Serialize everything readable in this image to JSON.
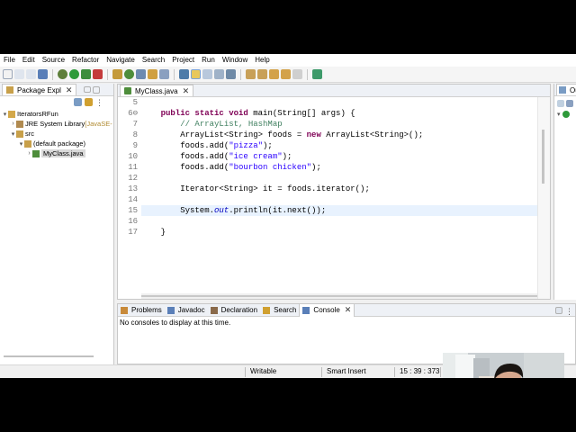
{
  "menu": [
    "File",
    "Edit",
    "Source",
    "Refactor",
    "Navigate",
    "Search",
    "Project",
    "Run",
    "Window",
    "Help"
  ],
  "package_explorer": {
    "tab_label": "Package Expl",
    "tree": [
      {
        "label": "IteratorsRFun",
        "icon": "project-icon",
        "depth": 0,
        "twisty": "▾"
      },
      {
        "label": "JRE System Library ",
        "suffix": "[JavaSE-",
        "icon": "library-icon",
        "depth": 1,
        "twisty": "›"
      },
      {
        "label": "src",
        "icon": "source-folder-icon",
        "depth": 1,
        "twisty": "▾"
      },
      {
        "label": "(default package)",
        "icon": "package-icon",
        "depth": 2,
        "twisty": "▾"
      },
      {
        "label": "MyClass.java",
        "icon": "java-file-icon",
        "depth": 3,
        "twisty": "›"
      }
    ]
  },
  "editor": {
    "tab_label": "MyClass.java",
    "lines": [
      {
        "n": "5",
        "html": ""
      },
      {
        "n": "6⊖",
        "html": "    <span class='kw'>public</span> <span class='kw'>static</span> <span class='kw'>void</span> main(String[] args) {"
      },
      {
        "n": "7",
        "html": "        <span class='cm'>// ArrayList, HashMap</span>"
      },
      {
        "n": "8",
        "html": "        ArrayList&lt;String&gt; foods = <span class='kw'>new</span> ArrayList&lt;String&gt;();"
      },
      {
        "n": "9",
        "html": "        foods.add(<span class='str'>\"pizza\"</span>);"
      },
      {
        "n": "10",
        "html": "        foods.add(<span class='str'>\"ice cream\"</span>);"
      },
      {
        "n": "11",
        "html": "        foods.add(<span class='str'>\"bourbon chicken\"</span>);"
      },
      {
        "n": "12",
        "html": ""
      },
      {
        "n": "13",
        "html": "        Iterator&lt;String&gt; it = foods.iterator();"
      },
      {
        "n": "14",
        "html": ""
      },
      {
        "n": "15",
        "html": "        System.<span class='st'>out</span>.println(it.next());"
      },
      {
        "n": "16",
        "html": ""
      },
      {
        "n": "17",
        "html": "    }"
      }
    ],
    "current_line_index": 10
  },
  "outline": {
    "tab_label": "Ou"
  },
  "console_panel": {
    "tabs": [
      "Problems",
      "Javadoc",
      "Declaration",
      "Search",
      "Console"
    ],
    "active_tab": "Console",
    "message": "No consoles to display at this time."
  },
  "status": {
    "writable": "Writable",
    "insert_mode": "Smart Insert",
    "position": "15 : 39 : 373"
  }
}
